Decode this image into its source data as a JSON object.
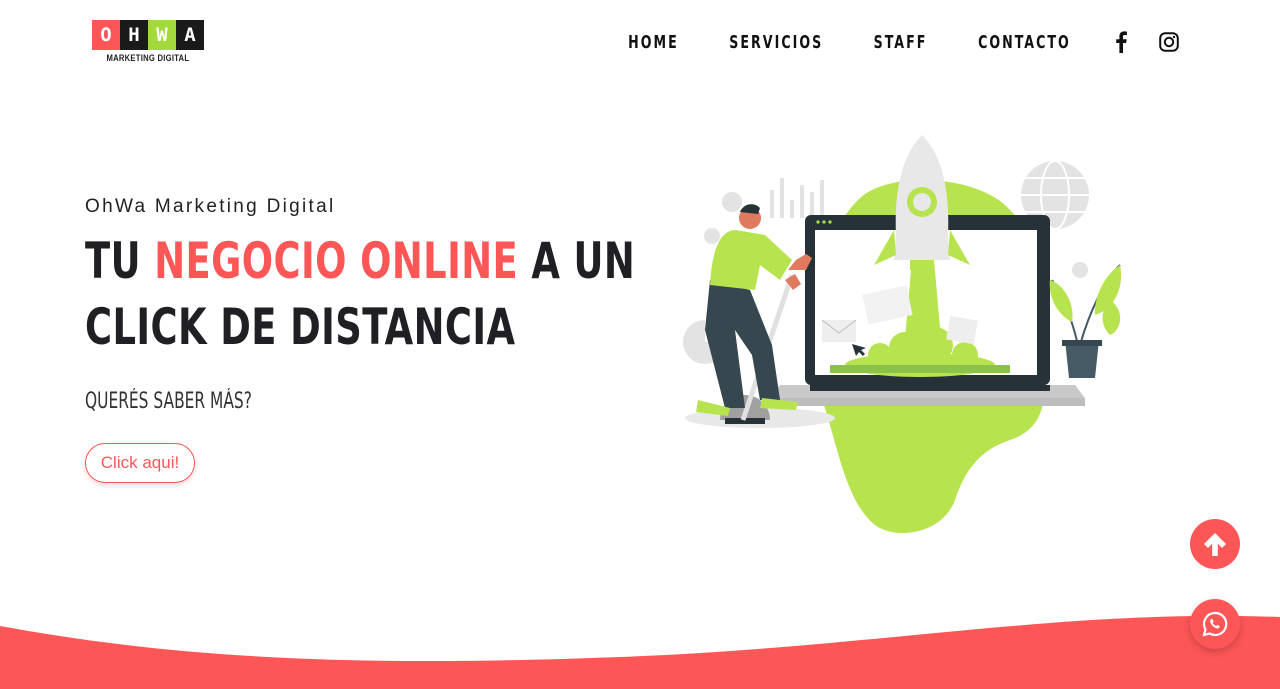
{
  "brand": {
    "letters": [
      "O",
      "H",
      "W",
      "A"
    ],
    "letter_colors": [
      "#fd5657",
      "#1a1a1a",
      "#a3d93b",
      "#1a1a1a"
    ],
    "tagline": "MARKETING DIGITAL"
  },
  "nav": {
    "items": [
      {
        "label": "HOME"
      },
      {
        "label": "SERVICIOS"
      },
      {
        "label": "STAFF"
      },
      {
        "label": "CONTACTO"
      }
    ],
    "icons": [
      "facebook-icon",
      "instagram-icon"
    ]
  },
  "hero": {
    "eyebrow": "OhWa Marketing Digital",
    "headline_part1": "TU ",
    "headline_accent": "NEGOCIO ONLINE",
    "headline_part2": " A UN",
    "headline_line2": "CLICK DE DISTANCIA",
    "subheading": "QUERÉS SABER MÁS?",
    "cta_label": "Click aqui!"
  },
  "floating": {
    "scroll_top_icon": "arrow-up-icon",
    "whatsapp_icon": "whatsapp-icon"
  },
  "colors": {
    "accent": "#fd5657",
    "green": "#b7e34f",
    "dark": "#1f1f24",
    "slate": "#37474f"
  }
}
